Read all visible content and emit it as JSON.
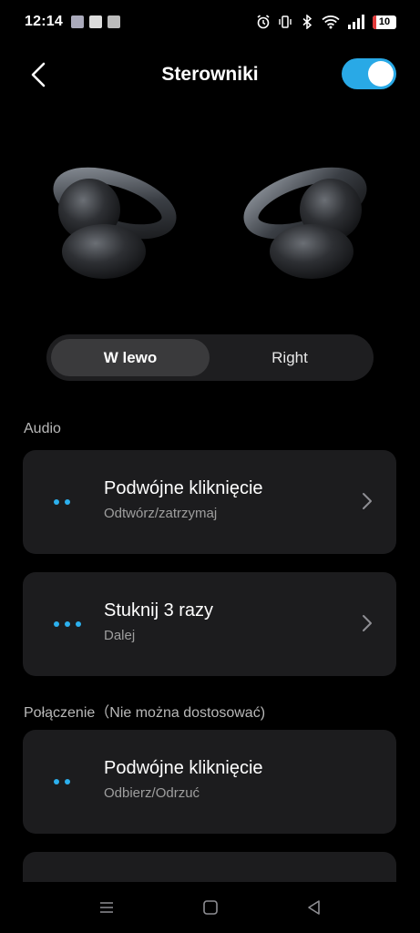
{
  "status_bar": {
    "time": "12:14",
    "battery": "10",
    "notification_icons": [
      "photos-icon",
      "ge-icon",
      "calendar-icon"
    ],
    "system_icons": [
      "alarm-icon",
      "vibrate-icon",
      "bluetooth-icon",
      "wifi-icon",
      "signal-icon"
    ]
  },
  "header": {
    "title": "Sterowniki",
    "back_icon": "chevron-left-icon",
    "toggle_on": true
  },
  "segment": {
    "left_label": "W lewo",
    "right_label": "Right",
    "selected": "left"
  },
  "sections": {
    "audio_label": "Audio",
    "connection_label": "Połączenie（Nie można dostosować)"
  },
  "cards": [
    {
      "dots": 2,
      "title": "Podwójne kliknięcie",
      "subtitle": "Odtwórz/zatrzymaj"
    },
    {
      "dots": 3,
      "title": "Stuknij 3 razy",
      "subtitle": "Dalej"
    },
    {
      "dots": 2,
      "title": "Podwójne kliknięcie",
      "subtitle": "Odbierz/Odrzuć"
    }
  ],
  "colors": {
    "accent": "#29a9e6",
    "card_bg": "#1c1c1e",
    "background": "#000000"
  },
  "nav": [
    "menu-icon",
    "home-icon",
    "back-icon"
  ]
}
